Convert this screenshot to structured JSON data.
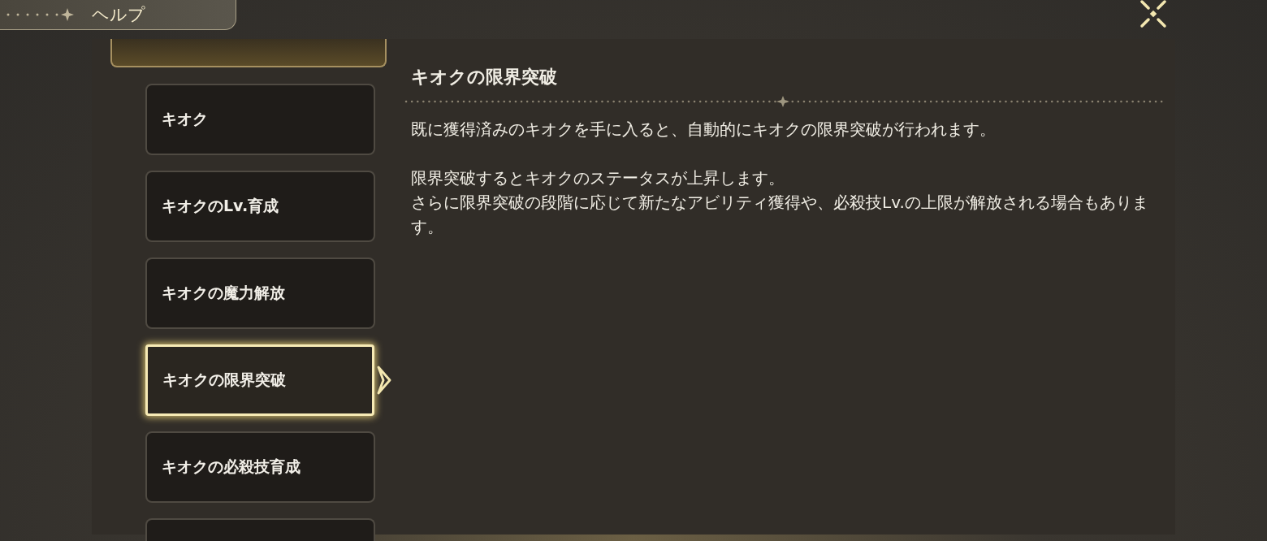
{
  "header": {
    "title": "ヘルプ"
  },
  "menu": [
    {
      "label": "キオク",
      "selected": false
    },
    {
      "label": "キオクのLv.育成",
      "selected": false
    },
    {
      "label": "キオクの魔力解放",
      "selected": false
    },
    {
      "label": "キオクの限界突破",
      "selected": true
    },
    {
      "label": "キオクの必殺技育成",
      "selected": false
    }
  ],
  "article": {
    "title": "キオクの限界突破",
    "paragraphs": [
      [
        "既に獲得済みのキオクを手に入ると、自動的にキオクの限界突破が行われます。"
      ],
      [
        "限界突破するとキオクのステータスが上昇します。",
        "さらに限界突破の段階に応じて新たなアビリティ獲得や、必殺技Lv.の上限が解放される場合もあります。"
      ]
    ]
  }
}
